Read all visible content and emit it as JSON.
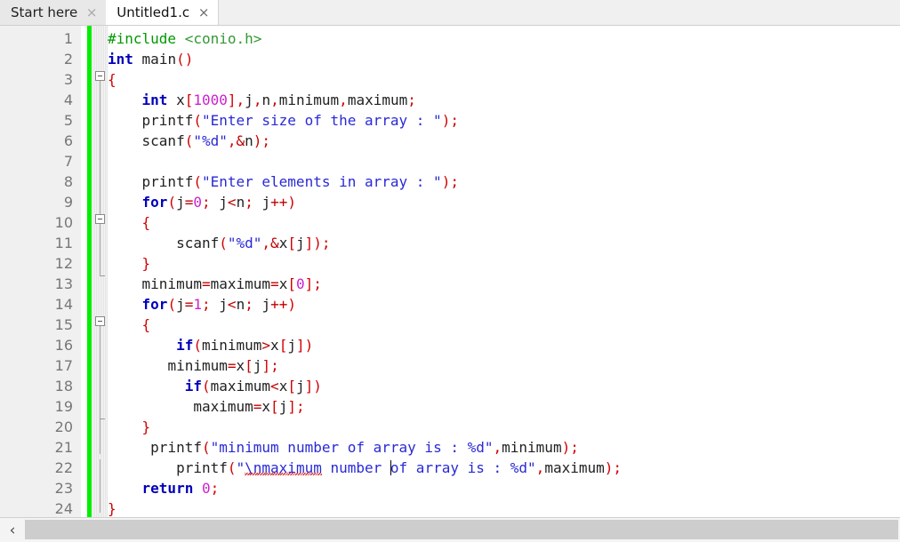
{
  "window": {
    "accent_changebar": "#00ee00",
    "gutter_bg": "#f0f0f0"
  },
  "tabbar": {
    "tabs": [
      {
        "label": "Start here",
        "active": false,
        "close_icon": "×"
      },
      {
        "label": "Untitled1.c",
        "active": true,
        "close_icon": "×"
      }
    ]
  },
  "editor": {
    "filename": "Untitled1.c",
    "language": "C",
    "line_numbers": [
      "1",
      "2",
      "3",
      "4",
      "5",
      "6",
      "7",
      "8",
      "9",
      "10",
      "11",
      "12",
      "13",
      "14",
      "15",
      "16",
      "17",
      "18",
      "19",
      "20",
      "21",
      "22",
      "23",
      "24"
    ],
    "lines": [
      {
        "n": "1",
        "text": "#include <conio.h>"
      },
      {
        "n": "2",
        "text": "int main()"
      },
      {
        "n": "3",
        "text": "{"
      },
      {
        "n": "4",
        "text": "    int x[1000],j,n,minimum,maximum;"
      },
      {
        "n": "5",
        "text": "    printf(\"Enter size of the array : \");"
      },
      {
        "n": "6",
        "text": "    scanf(\"%d\",&n);"
      },
      {
        "n": "7",
        "text": ""
      },
      {
        "n": "8",
        "text": "    printf(\"Enter elements in array : \");"
      },
      {
        "n": "9",
        "text": "    for(j=0; j<n; j++)"
      },
      {
        "n": "10",
        "text": "    {"
      },
      {
        "n": "11",
        "text": "        scanf(\"%d\",&x[j]);"
      },
      {
        "n": "12",
        "text": "    }"
      },
      {
        "n": "13",
        "text": "    minimum=maximum=x[0];"
      },
      {
        "n": "14",
        "text": "    for(j=1; j<n; j++)"
      },
      {
        "n": "15",
        "text": "    {"
      },
      {
        "n": "16",
        "text": "        if(minimum>x[j])"
      },
      {
        "n": "17",
        "text": "       minimum=x[j];"
      },
      {
        "n": "18",
        "text": "         if(maximum<x[j])"
      },
      {
        "n": "19",
        "text": "          maximum=x[j];"
      },
      {
        "n": "20",
        "text": "    }"
      },
      {
        "n": "21",
        "text": "     printf(\"minimum number of array is : %d\",minimum);"
      },
      {
        "n": "22",
        "text": "        printf(\"\\nmaximum number of array is : %d\",maximum);"
      },
      {
        "n": "23",
        "text": "    return 0;"
      },
      {
        "n": "24",
        "text": "}"
      }
    ],
    "fold_markers": [
      {
        "line": "3",
        "state": "expanded"
      },
      {
        "line": "10",
        "state": "expanded"
      },
      {
        "line": "15",
        "state": "expanded"
      }
    ],
    "spellcheck_word": "\\nmaximum",
    "caret_line": "22",
    "caret_before_word": "of"
  },
  "scrollbar": {
    "left_arrow": "‹"
  }
}
